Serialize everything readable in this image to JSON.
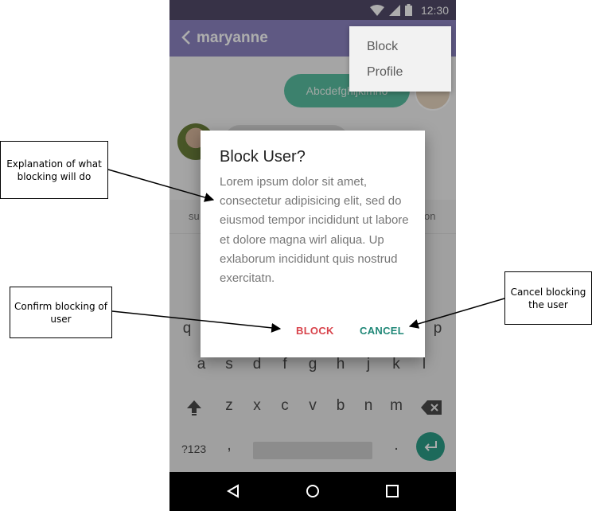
{
  "status_bar": {
    "time": "12:30"
  },
  "app_bar": {
    "title": "maryanne"
  },
  "chat": {
    "outgoing_text": "Abcdefghijklmno"
  },
  "overflow_menu": {
    "items": [
      "Block",
      "Profile"
    ]
  },
  "keyboard": {
    "suggestions": [
      "su",
      "on"
    ],
    "row1": [
      "q",
      "",
      "",
      "",
      "",
      "",
      "",
      "",
      "",
      "p"
    ],
    "row2": [
      "a",
      "s",
      "d",
      "f",
      "g",
      "h",
      "j",
      "k",
      "l"
    ],
    "row3": [
      "z",
      "x",
      "c",
      "v",
      "b",
      "n",
      "m"
    ],
    "symbols_label": "?123",
    "comma": ",",
    "period": "."
  },
  "dialog": {
    "title": "Block User?",
    "body": "Lorem ipsum dolor sit amet, consectetur adipisicing elit, sed do eiusmod tempor incididunt ut labore et dolore magna wirl aliqua. Up exlaborum incididunt quis nostrud exercitatn.",
    "block_label": "BLOCK",
    "cancel_label": "CANCEL"
  },
  "annotations": {
    "explanation": "Explanation of what blocking will do",
    "confirm": "Confirm blocking of user",
    "cancel": "Cancel blocking the user"
  },
  "colors": {
    "app_bar": "#8C84C2",
    "status_bar": "#514B69",
    "outgoing_bubble": "#59BFA1",
    "block_button": "#D8434B",
    "cancel_button": "#1F8777",
    "enter_key": "#2C9C86"
  },
  "icons": [
    "wifi-icon",
    "signal-icon",
    "battery-icon",
    "back-arrow-icon",
    "camera-add-icon",
    "send-icon",
    "shift-icon",
    "backspace-icon",
    "enter-icon",
    "nav-back-icon",
    "nav-home-icon",
    "nav-recents-icon"
  ]
}
